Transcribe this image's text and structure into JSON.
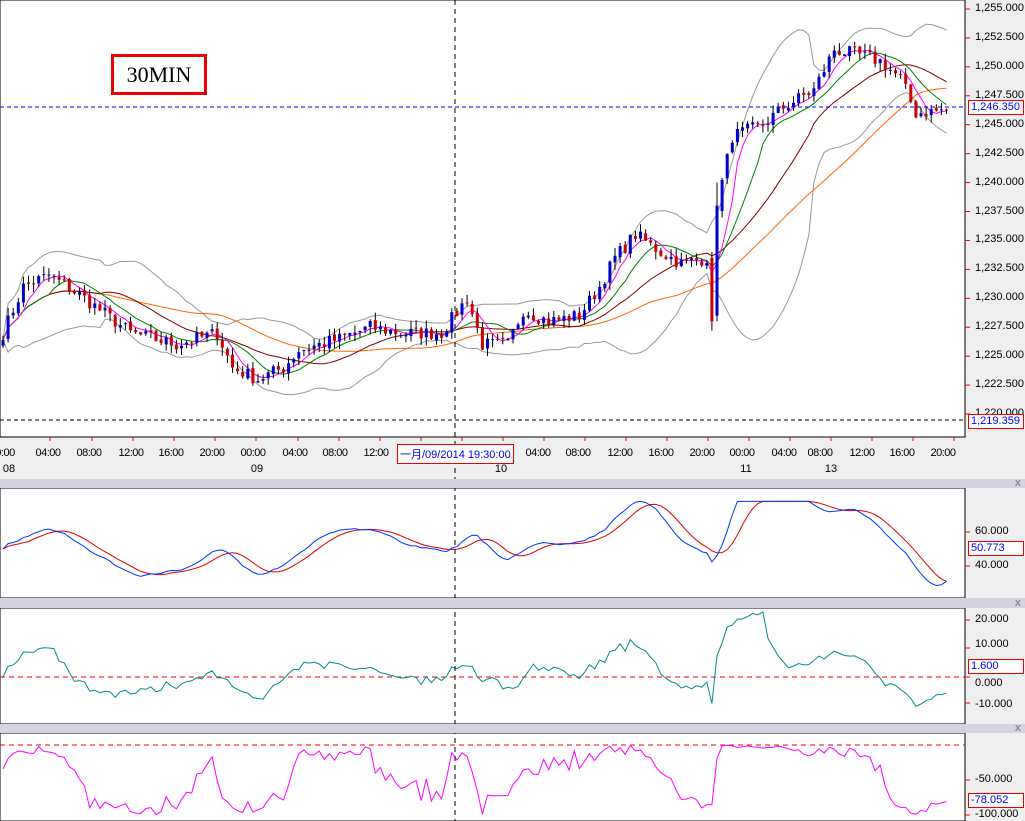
{
  "timeframe": "30MIN",
  "price_axis": {
    "ticks": [
      "1,255.000",
      "1,252.500",
      "1,250.000",
      "1,247.500",
      "1,245.000",
      "1,242.500",
      "1,240.000",
      "1,237.500",
      "1,235.000",
      "1,232.500",
      "1,230.000",
      "1,227.500",
      "1,225.000",
      "1,222.500",
      "1,220.000"
    ],
    "current_price": "1,246.350",
    "crosshair_price": "1,219.359"
  },
  "time_axis": {
    "times": [
      "0:00",
      "04:00",
      "08:00",
      "12:00",
      "16:00",
      "20:00",
      "00:00",
      "04:00",
      "08:00",
      "12:00",
      "04:00",
      "08:00",
      "12:00",
      "16:00",
      "20:00",
      "00:00",
      "04:00",
      "08:00",
      "12:00",
      "16:00",
      "20:00"
    ],
    "dates": [
      "08",
      "09",
      "10",
      "11",
      "13"
    ],
    "crosshair_time": "一月/09/2014 19:30:00"
  },
  "panel1": {
    "ticks": [
      "60.000",
      "40.000"
    ],
    "value": "50.773"
  },
  "panel2": {
    "ticks": [
      "20.000",
      "10.000",
      "0.000",
      "-10.000"
    ],
    "value": "1.600"
  },
  "panel3": {
    "ticks": [
      "-50.000",
      "-100.000"
    ],
    "value": "-78.052"
  },
  "close_label": "x",
  "colors": {
    "up": "#0000cc",
    "down": "#cc0000",
    "ma5": "#ff00ff",
    "ma10": "#008000",
    "ma20": "#800000",
    "ma40": "#ff6600",
    "bands": "#999999",
    "osc1a": "#0033ff",
    "osc1b": "#dd0000",
    "osc2": "#008b8b",
    "osc3": "#ff00ff"
  },
  "chart_data": {
    "type": "candlestick",
    "bars": 186,
    "price_ylim": [
      1219,
      1255.5
    ],
    "anchors": [
      [
        0,
        1227
      ],
      [
        4,
        1231
      ],
      [
        9,
        1232
      ],
      [
        16,
        1230
      ],
      [
        19,
        1229
      ],
      [
        25,
        1227
      ],
      [
        34,
        1226
      ],
      [
        42,
        1227
      ],
      [
        45,
        1224
      ],
      [
        50,
        1223
      ],
      [
        55,
        1224
      ],
      [
        58,
        1225.5
      ],
      [
        66,
        1226.5
      ],
      [
        72,
        1227.5
      ],
      [
        78,
        1227
      ],
      [
        86,
        1227
      ],
      [
        91,
        1230
      ],
      [
        94,
        1226
      ],
      [
        99,
        1226
      ],
      [
        102,
        1229
      ],
      [
        107,
        1228
      ],
      [
        113,
        1228.5
      ],
      [
        117,
        1231
      ],
      [
        120,
        1233.5
      ],
      [
        124,
        1235.5
      ],
      [
        129,
        1234
      ],
      [
        133,
        1233
      ],
      [
        138,
        1233.5
      ],
      [
        139,
        1228
      ],
      [
        140,
        1238
      ],
      [
        143,
        1244
      ],
      [
        149,
        1245
      ],
      [
        153,
        1246.5
      ],
      [
        159,
        1248
      ],
      [
        163,
        1251.5
      ],
      [
        168,
        1251
      ],
      [
        172,
        1250.5
      ],
      [
        176,
        1249
      ],
      [
        179,
        1246
      ],
      [
        185,
        1246.3
      ]
    ]
  }
}
